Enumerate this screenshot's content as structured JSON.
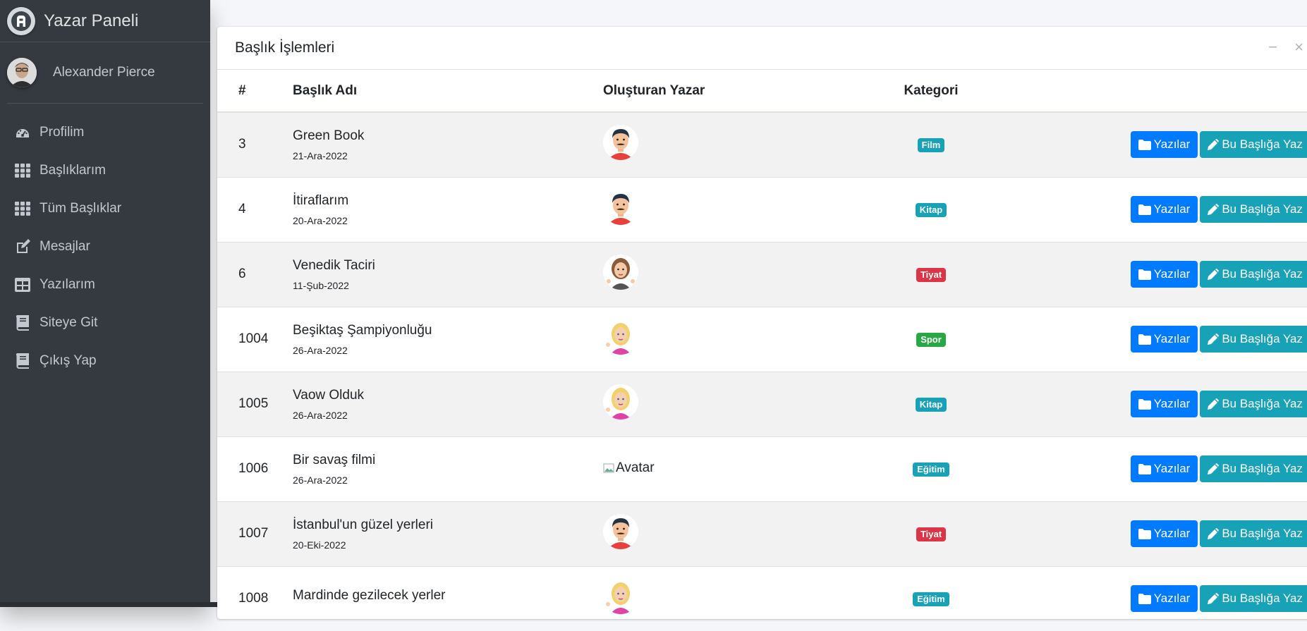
{
  "brand": {
    "title": "Yazar Paneli",
    "logo_letter": "A"
  },
  "user": {
    "name": "Alexander Pierce"
  },
  "nav": [
    {
      "label": "Profilim",
      "icon": "dashboard-icon"
    },
    {
      "label": "Başlıklarım",
      "icon": "grid-icon"
    },
    {
      "label": "Tüm Başlıklar",
      "icon": "grid-icon"
    },
    {
      "label": "Mesajlar",
      "icon": "edit-icon"
    },
    {
      "label": "Yazılarım",
      "icon": "table-icon"
    },
    {
      "label": "Siteye Git",
      "icon": "book-icon"
    },
    {
      "label": "Çıkış Yap",
      "icon": "book-icon"
    }
  ],
  "card": {
    "title": "Başlık İşlemleri",
    "minimize": "−",
    "close": "×"
  },
  "table": {
    "headers": [
      "#",
      "Başlık Adı",
      "Oluşturan Yazar",
      "Kategori"
    ],
    "rows": [
      {
        "id": "3",
        "title": "Green Book",
        "date": "21-Ara-2022",
        "avatar": "man",
        "category": "Film",
        "cat_color": "#17a2b8"
      },
      {
        "id": "4",
        "title": "İtiraflarım",
        "date": "20-Ara-2022",
        "avatar": "man",
        "category": "Kitap",
        "cat_color": "#17a2b8"
      },
      {
        "id": "6",
        "title": "Venedik Taciri",
        "date": "11-Şub-2022",
        "avatar": "woman-brown",
        "category": "Tiyat",
        "cat_color": "#dc3545"
      },
      {
        "id": "1004",
        "title": "Beşiktaş Şampiyonluğu",
        "date": "26-Ara-2022",
        "avatar": "woman-blonde",
        "category": "Spor",
        "cat_color": "#28a745"
      },
      {
        "id": "1005",
        "title": "Vaow Olduk",
        "date": "26-Ara-2022",
        "avatar": "woman-blonde",
        "category": "Kitap",
        "cat_color": "#17a2b8"
      },
      {
        "id": "1006",
        "title": "Bir savaş filmi",
        "date": "26-Ara-2022",
        "avatar": "broken",
        "avatar_alt": "Avatar",
        "category": "Eğitim",
        "cat_color": "#17a2b8"
      },
      {
        "id": "1007",
        "title": "İstanbul'un güzel yerleri",
        "date": "20-Eki-2022",
        "avatar": "man",
        "category": "Tiyat",
        "cat_color": "#dc3545"
      },
      {
        "id": "1008",
        "title": "Mardinde gezilecek yerler",
        "date": "",
        "avatar": "woman-blonde",
        "category": "Eğitim",
        "cat_color": "#17a2b8"
      }
    ],
    "btn_posts": "Yazılar",
    "btn_write": "Bu Başlığa Yaz"
  }
}
